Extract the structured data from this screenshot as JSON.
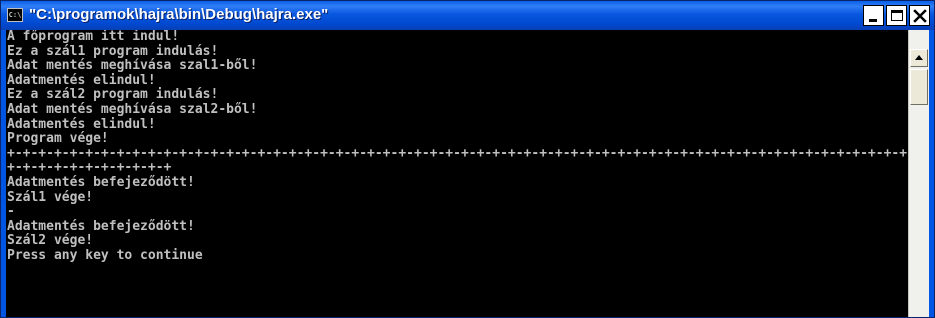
{
  "window": {
    "title": "\"C:\\programok\\hajra\\bin\\Debug\\hajra.exe\"",
    "icon_label": "C:\\",
    "icon_name": "console-app-icon"
  },
  "controls": {
    "minimize": "minimize-icon",
    "maximize": "maximize-icon",
    "close": "close-icon"
  },
  "console": {
    "lines": [
      "A főprogram itt indul!",
      "Ez a szál1 program indulás!",
      "Adat mentés meghívása szal1-ből!",
      "Adatmentés elindul!",
      "Ez a szál2 program indulás!",
      "Adat mentés meghívása szal2-ből!",
      "Adatmentés elindul!",
      "Program vége!",
      "+-+-+-+-+-+-+-+-+-+-+-+-+-+-+-+-+-+-+-+-+-+-+-+-+-+-+-+-+-+-+-+-+-+-+-+-+-+-+-+-+-+-+-+-+-+-+-+-+-+-+-+-+-+-+-+-+-+-+-+-+-+-+",
      "+-+-+-+-+-+-+-+-+-+-+",
      "Adatmentés befejeződött!",
      "Szál1 vége!",
      "-",
      "Adatmentés befejeződött!",
      "Szál2 vége!",
      "Press any key to continue"
    ]
  },
  "colors": {
    "titlebar": "#0055e5",
    "console_bg": "#000000",
    "console_text": "#c0c0c0"
  }
}
